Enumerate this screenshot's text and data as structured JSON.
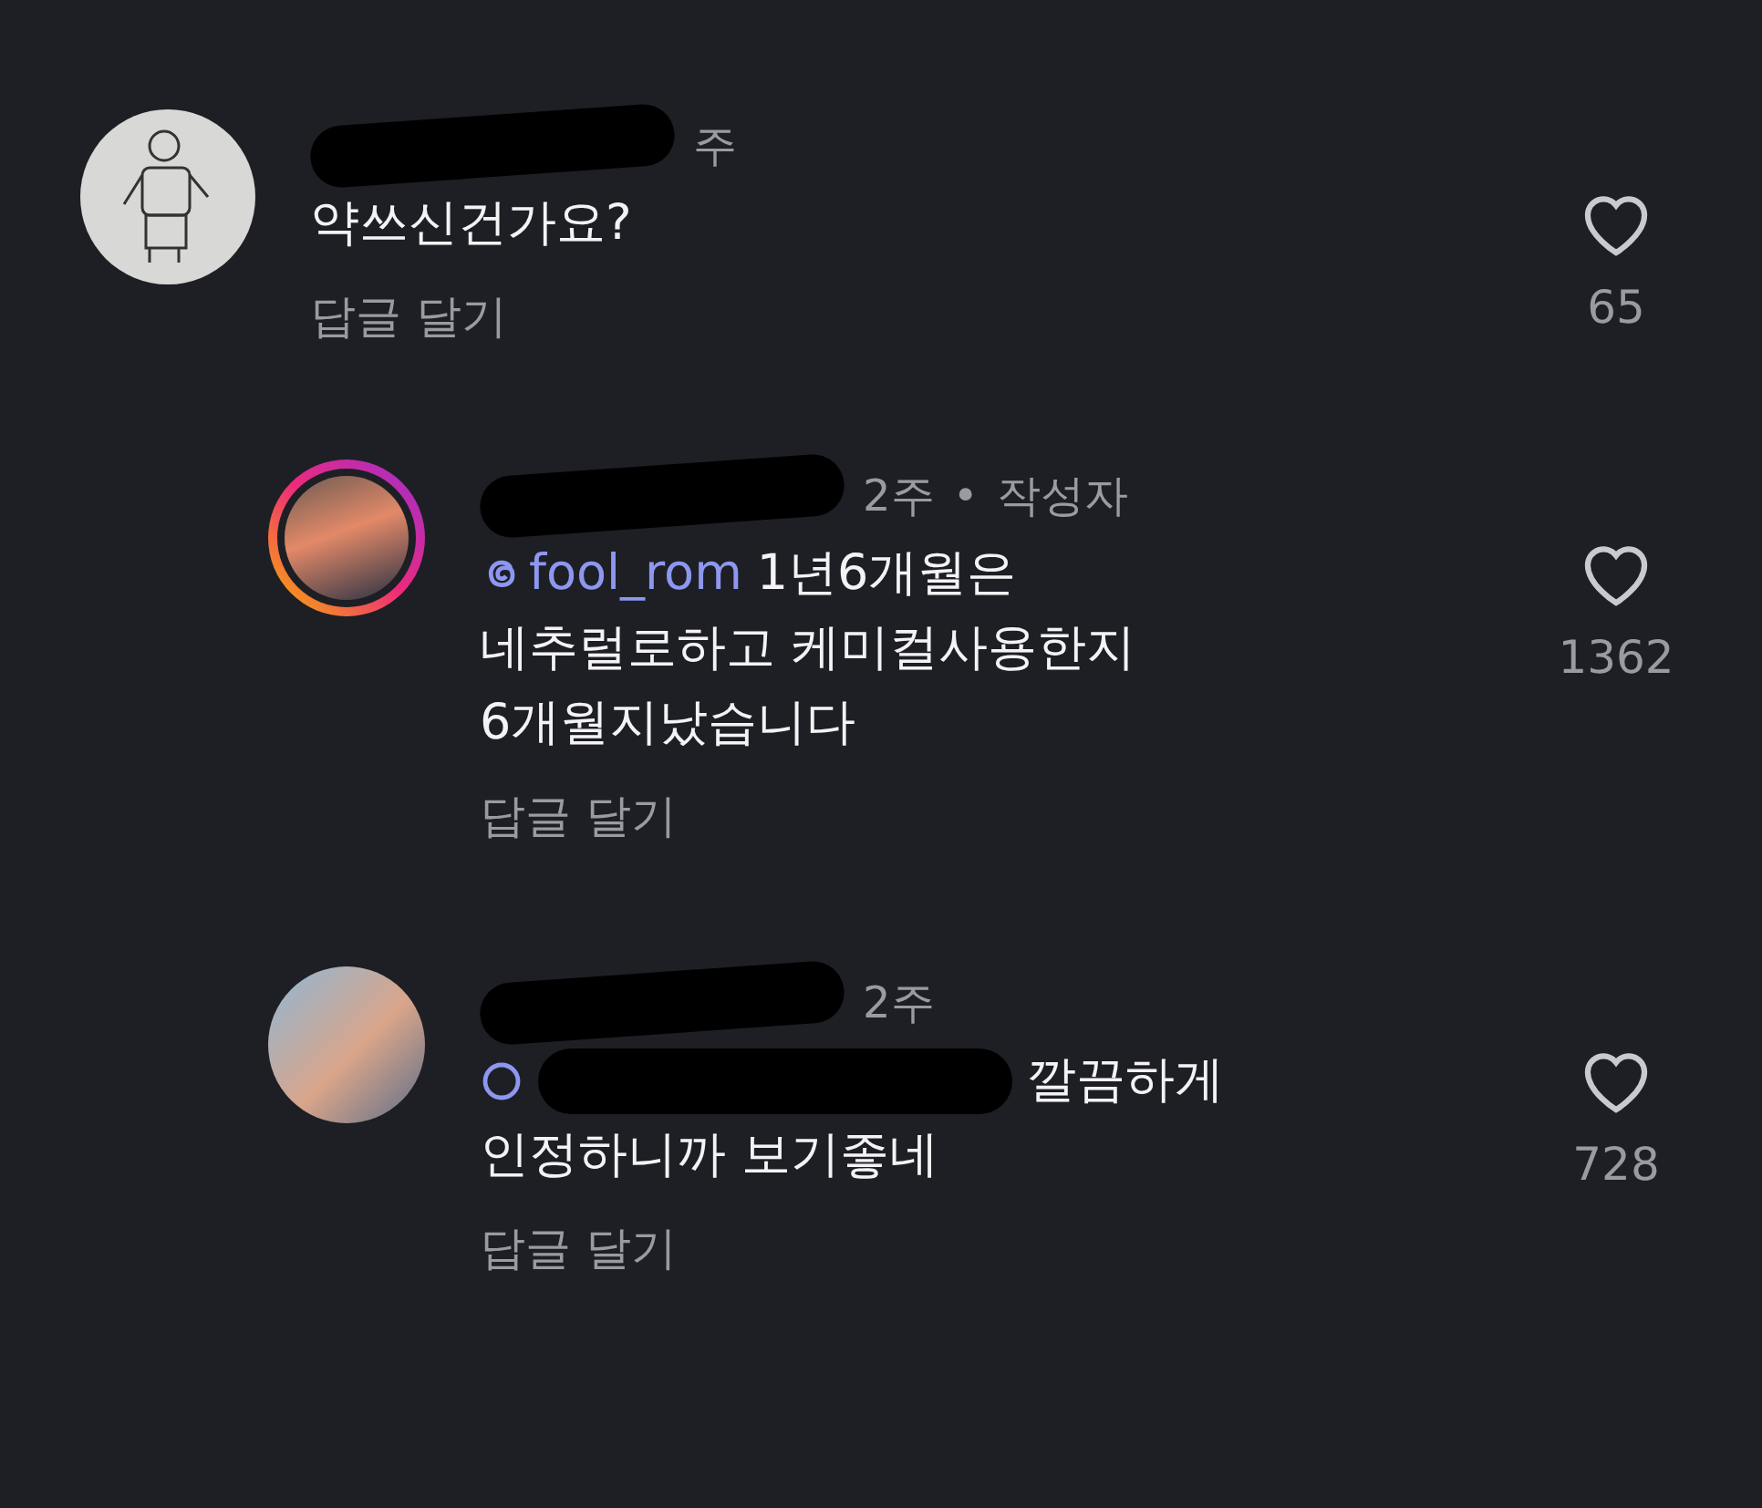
{
  "comments": [
    {
      "kind": "top",
      "avatar": {
        "kind": "drawing",
        "story_ring": false
      },
      "name_redacted": true,
      "time": "주",
      "lines": [
        "약쓰신건가요?"
      ],
      "reply_label": "답글 달기",
      "likes": "65"
    },
    {
      "kind": "reply",
      "avatar": {
        "kind": "photo",
        "story_ring": true
      },
      "name_redacted": true,
      "time": "2주",
      "separator": "•",
      "badge": "작성자",
      "mention": {
        "text": "fool_rom",
        "redacted": false
      },
      "lines": [
        "1년6개월은",
        "네추럴로하고 케미컬사용한지",
        "6개월지났습니다"
      ],
      "reply_label": "답글 달기",
      "likes": "1362"
    },
    {
      "kind": "reply",
      "avatar": {
        "kind": "photo",
        "story_ring": false
      },
      "name_redacted": true,
      "time": "2주",
      "mention": {
        "redacted": true
      },
      "lines": [
        "깔끔하게",
        "인정하니까 보기좋네"
      ],
      "reply_label": "답글 달기",
      "likes": "728"
    }
  ]
}
